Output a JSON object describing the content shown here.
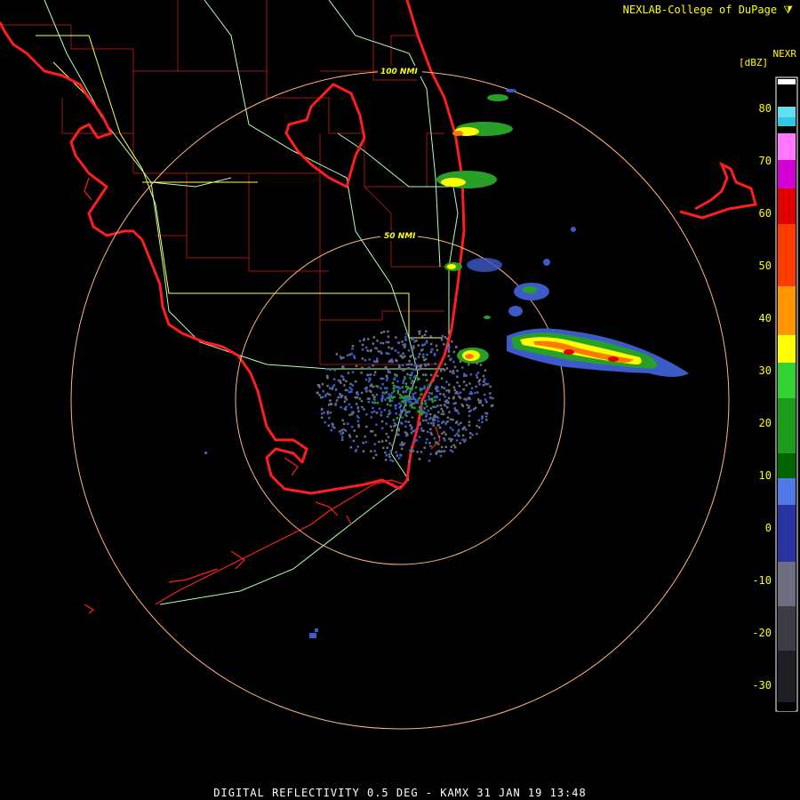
{
  "header": {
    "credit": "NEXLAB-College of DuPage"
  },
  "legend": {
    "title": "NEXR",
    "unit": "[dBZ]",
    "ticks": [
      {
        "label": "80",
        "value": 80
      },
      {
        "label": "70",
        "value": 70
      },
      {
        "label": "60",
        "value": 60
      },
      {
        "label": "50",
        "value": 50
      },
      {
        "label": "40",
        "value": 40
      },
      {
        "label": "30",
        "value": 30
      },
      {
        "label": "20",
        "value": 20
      },
      {
        "label": "10",
        "value": 10
      },
      {
        "label": "0",
        "value": 0
      },
      {
        "label": "-10",
        "value": -10
      },
      {
        "label": "-20",
        "value": -20
      },
      {
        "label": "-30",
        "value": -30
      }
    ],
    "colors": {
      "text": "#ffff00",
      "band_gray": "#5a5a6e",
      "band_blue": "#3c5ac8",
      "band_green": "#28a028",
      "band_yellow": "#ffff00",
      "band_red": "#e00000",
      "band_magenta": "#ff40ff",
      "band_cyan": "#30c8e0"
    }
  },
  "range_rings": [
    {
      "label": "50 NMI"
    },
    {
      "label": "100 NMI"
    }
  ],
  "map_colors": {
    "coast": "#ff1e1e",
    "county": "#a01414",
    "highway": "#b4ffb4",
    "state_road": "#ffff50",
    "ring": "#ffb482"
  },
  "footer": {
    "text": "DIGITAL REFLECTIVITY 0.5 DEG - KAMX 31 JAN 19 13:48"
  }
}
